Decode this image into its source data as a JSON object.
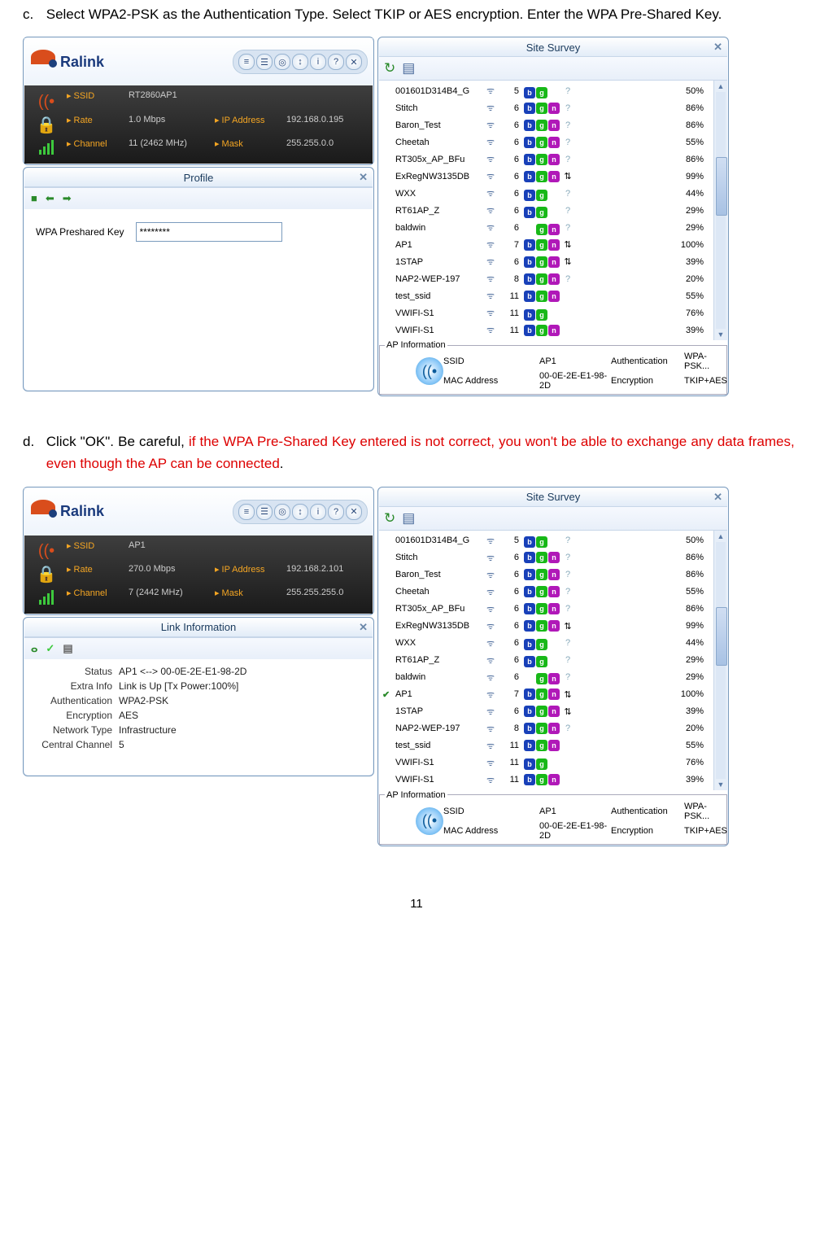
{
  "instr_c": {
    "marker": "c.",
    "text": "Select WPA2-PSK as the Authentication Type. Select TKIP or AES encryption. Enter the WPA Pre-Shared Key."
  },
  "instr_d": {
    "marker": "d.",
    "text_black": "Click \"OK\". Be careful, ",
    "text_red": "if the WPA Pre-Shared Key entered is not correct, you won't be able to exchange any data frames, even though the AP can be connected",
    "period": "."
  },
  "ralink": "Ralink",
  "icons": [
    "≡",
    "☰",
    "◎",
    "↕",
    "i",
    "?",
    "✕"
  ],
  "shot1": {
    "info": {
      "ssid_l": "SSID",
      "ssid": "RT2860AP1",
      "rate_l": "Rate",
      "rate": "1.0 Mbps",
      "ip_l": "IP Address",
      "ip": "192.168.0.195",
      "chan_l": "Channel",
      "chan": "11 (2462 MHz)",
      "mask_l": "Mask",
      "mask": "255.255.0.0"
    },
    "profile_title": "Profile",
    "nav_icons": [
      "■",
      "⬅",
      "➡"
    ],
    "psk_label": "WPA Preshared Key",
    "psk_value": "********"
  },
  "shot2": {
    "info": {
      "ssid_l": "SSID",
      "ssid": "AP1",
      "rate_l": "Rate",
      "rate": "270.0 Mbps",
      "ip_l": "IP Address",
      "ip": "192.168.2.101",
      "chan_l": "Channel",
      "chan": "7 (2442 MHz)",
      "mask_l": "Mask",
      "mask": "255.255.255.0"
    },
    "link_title": "Link Information",
    "link_icons": [
      "ⴰ",
      "✓",
      "▤"
    ],
    "link": {
      "status_l": "Status",
      "status": "AP1 <--> 00-0E-2E-E1-98-2D",
      "extra_l": "Extra Info",
      "extra": "Link is Up  [Tx Power:100%]",
      "auth_l": "Authentication",
      "auth": "WPA2-PSK",
      "enc_l": "Encryption",
      "enc": "AES",
      "net_l": "Network Type",
      "net": "Infrastructure",
      "cc_l": "Central Channel",
      "cc": "5"
    }
  },
  "site_survey": {
    "title": "Site Survey",
    "list": [
      {
        "name": "001601D314B4_G",
        "ch": "5",
        "b": true,
        "g": true,
        "n": false,
        "lock": "?",
        "sig": "50%"
      },
      {
        "name": "Stitch",
        "ch": "6",
        "b": true,
        "g": true,
        "n": true,
        "lock": "?",
        "sig": "86%"
      },
      {
        "name": "Baron_Test",
        "ch": "6",
        "b": true,
        "g": true,
        "n": true,
        "lock": "?",
        "sig": "86%"
      },
      {
        "name": "Cheetah",
        "ch": "6",
        "b": true,
        "g": true,
        "n": true,
        "lock": "?",
        "sig": "55%"
      },
      {
        "name": "RT305x_AP_BFu",
        "ch": "6",
        "b": true,
        "g": true,
        "n": true,
        "lock": "?",
        "sig": "86%"
      },
      {
        "name": "ExRegNW3135DB",
        "ch": "6",
        "b": true,
        "g": true,
        "n": true,
        "lock": "⇅",
        "sig": "99%"
      },
      {
        "name": "WXX",
        "ch": "6",
        "b": true,
        "g": true,
        "n": false,
        "lock": "?",
        "sig": "44%"
      },
      {
        "name": "RT61AP_Z",
        "ch": "6",
        "b": true,
        "g": true,
        "n": false,
        "lock": "?",
        "sig": "29%"
      },
      {
        "name": "baldwin",
        "ch": "6",
        "b": false,
        "g": true,
        "n": true,
        "lock": "?",
        "sig": "29%"
      },
      {
        "name": "AP1",
        "ch": "7",
        "b": true,
        "g": true,
        "n": true,
        "lock": "⇅",
        "sig": "100%",
        "sel": true
      },
      {
        "name": "1STAP",
        "ch": "6",
        "b": true,
        "g": true,
        "n": true,
        "lock": "⇅",
        "sig": "39%"
      },
      {
        "name": "NAP2-WEP-197",
        "ch": "8",
        "b": true,
        "g": true,
        "n": true,
        "lock": "?",
        "sig": "20%"
      },
      {
        "name": "test_ssid",
        "ch": "11",
        "b": true,
        "g": true,
        "n": true,
        "lock": "",
        "sig": "55%"
      },
      {
        "name": "VWIFI-S1",
        "ch": "11",
        "b": true,
        "g": true,
        "n": false,
        "lock": "",
        "sig": "76%"
      },
      {
        "name": "VWIFI-S1",
        "ch": "11",
        "b": true,
        "g": true,
        "n": true,
        "lock": "",
        "sig": "39%"
      }
    ],
    "apinfo": {
      "legend": "AP Information",
      "ssid_l": "SSID",
      "ssid": "AP1",
      "auth_l": "Authentication",
      "auth": "WPA-PSK...",
      "mac_l": "MAC Address",
      "mac": "00-0E-2E-E1-98-2D",
      "enc_l": "Encryption",
      "enc": "TKIP+AES"
    }
  },
  "page_num": "11"
}
